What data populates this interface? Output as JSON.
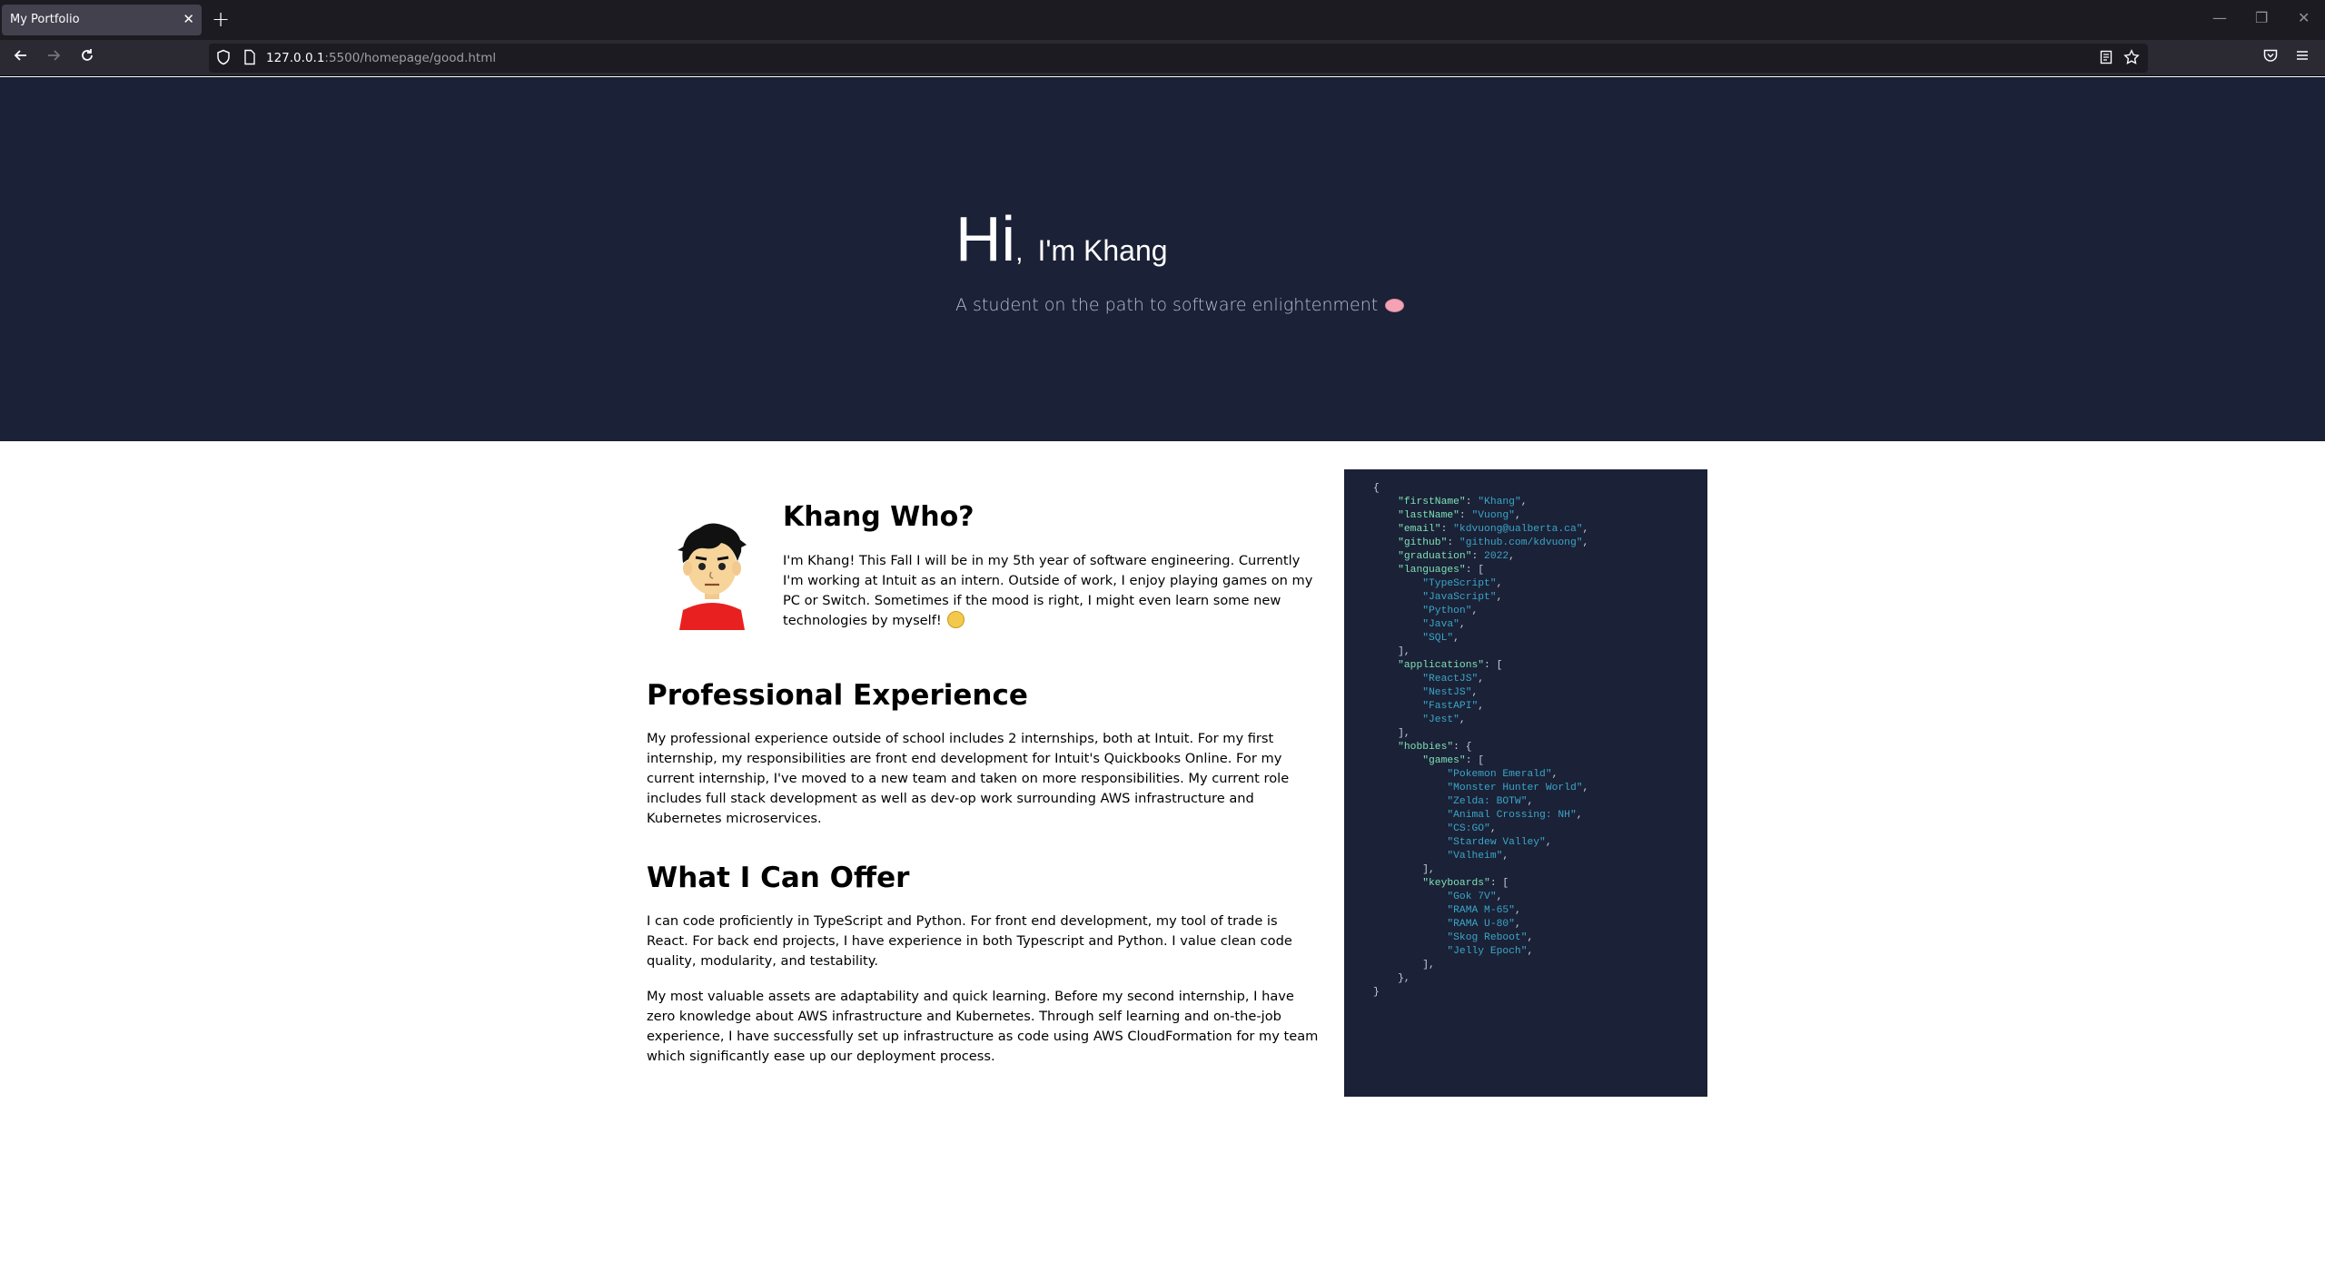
{
  "browser": {
    "tab_title": "My Portfolio",
    "tab_close": "✕",
    "new_tab": "+",
    "url_host": "127.0.0.1",
    "url_rest": ":5500/homepage/good.html",
    "window_controls": {
      "minimize": "—",
      "restore": "❐",
      "close": "✕"
    },
    "icons": [
      "back-icon",
      "forward-icon",
      "reload-icon",
      "shield-icon",
      "page-icon",
      "reader-view-icon",
      "bookmark-star-icon",
      "pocket-icon",
      "menu-icon"
    ]
  },
  "hero": {
    "hi": "Hi",
    "comma": ",",
    "name": "I'm Khang",
    "subtitle": "A student on the path to software enlightenment"
  },
  "about": {
    "heading": "Khang Who?",
    "text": "I'm Khang! This Fall I will be in my 5th year of software engineering. Currently I'm working at Intuit as an intern. Outside of work, I enjoy playing games on my PC or Switch. Sometimes if the mood is right, I might even learn some new technologies by myself!"
  },
  "experience": {
    "heading": "Professional Experience",
    "text": "My professional experience outside of school includes 2 internships, both at Intuit. For my first internship, my responsibilities are front end development for Intuit's Quickbooks Online. For my current internship, I've moved to a new team and taken on more responsibilities. My current role includes full stack development as well as dev-op work surrounding AWS infrastructure and Kubernetes microservices."
  },
  "offer": {
    "heading": "What I Can Offer",
    "text1": "I can code proficiently in TypeScript and Python. For front end development, my tool of trade is React. For back end projects, I have experience in both Typescript and Python. I value clean code quality, modularity, and testability.",
    "text2": "My most valuable assets are adaptability and quick learning. Before my second internship, I have zero knowledge about AWS infrastructure and Kubernetes. Through self learning and on-the-job experience, I have successfully set up infrastructure as code using AWS CloudFormation for my team which significantly ease up our deployment process."
  },
  "profile": {
    "firstName": "Khang",
    "lastName": "Vuong",
    "email": "kdvuong@ualberta.ca",
    "github": "github.com/kdvuong",
    "graduation": "2022",
    "languages": [
      "TypeScript",
      "JavaScript",
      "Python",
      "Java",
      "SQL"
    ],
    "applications": [
      "ReactJS",
      "NestJS",
      "FastAPI",
      "Jest"
    ],
    "games": [
      "Pokemon Emerald",
      "Monster Hunter World",
      "Zelda: BOTW",
      "Animal Crossing: NH",
      "CS:GO",
      "Stardew Valley",
      "Valheim"
    ],
    "keyboards": [
      "Gok 7V",
      "RAMA M-65",
      "RAMA U-80",
      "Skog Reboot",
      "Jelly Epoch"
    ]
  },
  "colors": {
    "hero_bg": "#1b2136",
    "code_key": "#7ee2b8",
    "code_string": "#3aa6c9",
    "code_punct": "#c9d1d9"
  }
}
